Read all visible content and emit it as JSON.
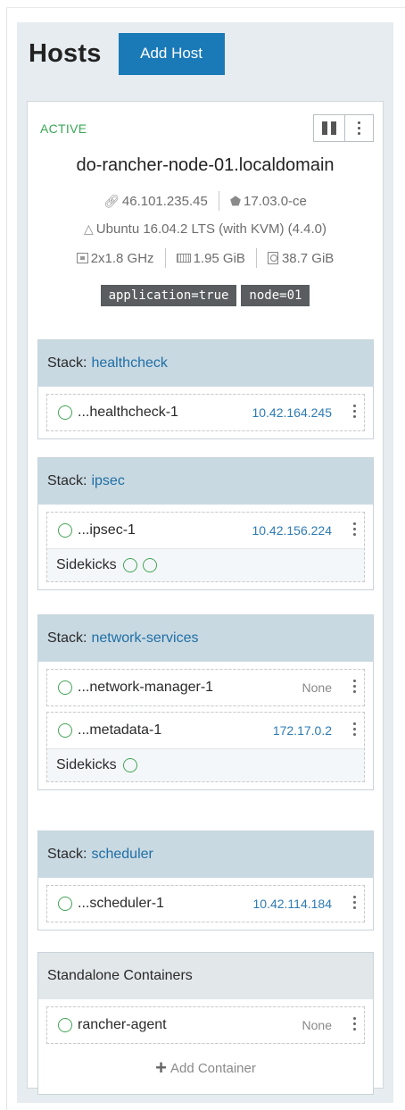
{
  "header": {
    "title": "Hosts",
    "add_host_label": "Add Host"
  },
  "host": {
    "status": "ACTIVE",
    "name": "do-rancher-node-01.localdomain",
    "ip": "46.101.235.45",
    "docker_version": "17.03.0-ce",
    "os": "Ubuntu 16.04.2 LTS (with KVM) (4.4.0)",
    "cpu": "2x1.8 GHz",
    "memory": "1.95 GiB",
    "storage": "38.7 GiB",
    "labels": [
      "application=true",
      "node=01"
    ]
  },
  "stacks": [
    {
      "prefix": "Stack:",
      "name": "healthcheck",
      "containers": [
        {
          "name": "...healthcheck-1",
          "ip": "10.42.164.245"
        }
      ]
    },
    {
      "prefix": "Stack:",
      "name": "ipsec",
      "containers": [
        {
          "name": "...ipsec-1",
          "ip": "10.42.156.224",
          "sidekicks_label": "Sidekicks",
          "sidekick_count": 2
        }
      ]
    },
    {
      "prefix": "Stack:",
      "name": "network-services",
      "containers": [
        {
          "name": "...network-manager-1",
          "ip": "None"
        },
        {
          "name": "...metadata-1",
          "ip": "172.17.0.2",
          "sidekicks_label": "Sidekicks",
          "sidekick_count": 1
        }
      ]
    },
    {
      "prefix": "Stack:",
      "name": "scheduler",
      "containers": [
        {
          "name": "...scheduler-1",
          "ip": "10.42.114.184"
        }
      ]
    }
  ],
  "standalone": {
    "title": "Standalone Containers",
    "containers": [
      {
        "name": "rancher-agent",
        "ip": "None"
      }
    ],
    "add_container_label": "Add Container"
  },
  "colors": {
    "accent": "#1a7ab8",
    "active": "#3aa756",
    "stack_header": "#c9d9e2",
    "link": "#1f6fa5"
  }
}
